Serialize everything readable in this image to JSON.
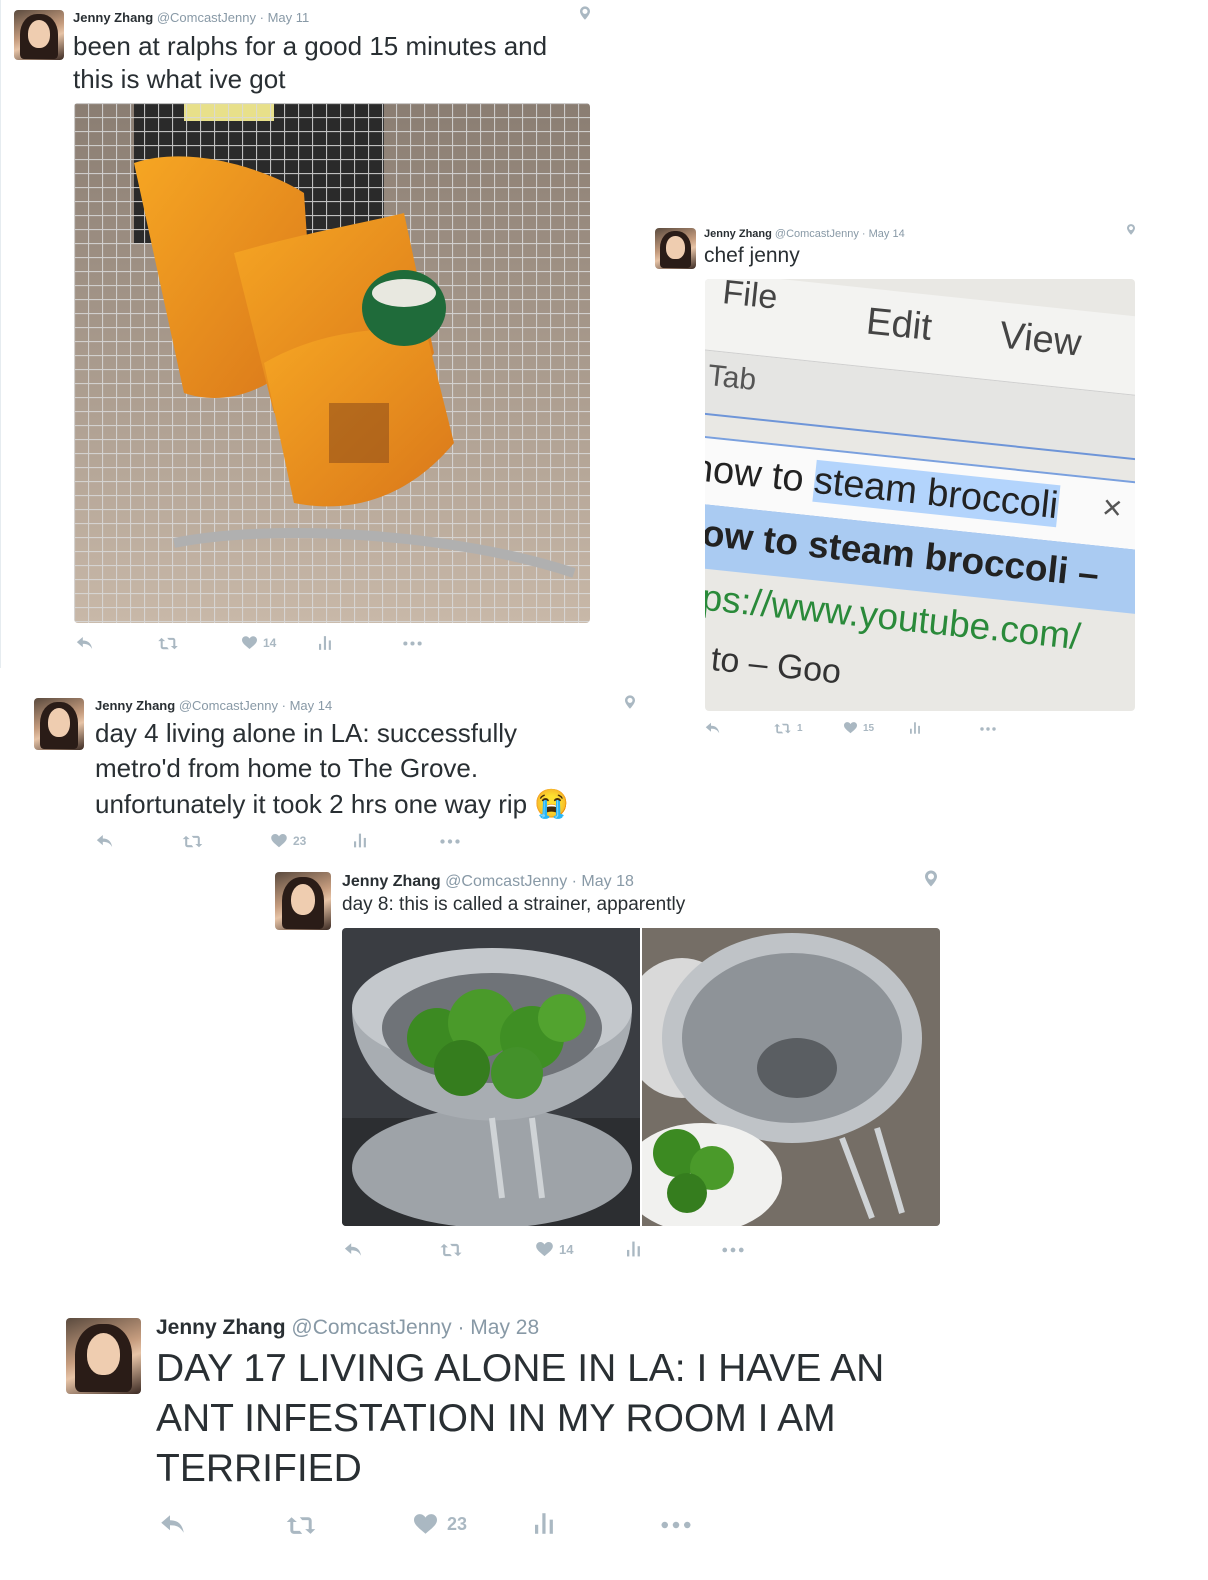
{
  "tweets": [
    {
      "name": "Jenny Zhang",
      "handle": "@ComcastJenny",
      "date": "· May 11",
      "text_line1": "been at ralphs for a good 15 minutes and",
      "text_line2": "this is what ive got",
      "likes": "14"
    },
    {
      "name": "Jenny Zhang",
      "handle": "@ComcastJenny",
      "date": "· May 14",
      "text": "chef jenny",
      "retweets": "1",
      "likes": "15",
      "screenshot": {
        "menu_file": "File",
        "menu_edit": "Edit",
        "menu_view": "View",
        "tab": "Tab",
        "search_prefix": "how to ",
        "search_highlight": "steam broccoli",
        "close": "×",
        "suggest_1": "how to steam broccoli –",
        "suggest_2": "https://www.youtube.com/",
        "suggest_3": "ow to – Goo"
      }
    },
    {
      "name": "Jenny Zhang",
      "handle": "@ComcastJenny",
      "date": "· May 14",
      "text_line1": "day 4 living alone in LA: successfully",
      "text_line2": "metro'd from home to The Grove.",
      "text_line3": "unfortunately it took 2 hrs one way rip",
      "emoji": "😭",
      "likes": "23"
    },
    {
      "name": "Jenny Zhang",
      "handle": "@ComcastJenny",
      "date": "· May 18",
      "text": "day 8: this is called a strainer, apparently",
      "likes": "14"
    },
    {
      "name": "Jenny Zhang",
      "handle": "@ComcastJenny",
      "date": "· May 28",
      "text_line1": "DAY 17 LIVING ALONE IN LA: I HAVE AN",
      "text_line2": "ANT INFESTATION IN MY ROOM I AM",
      "text_line3": "TERRIFIED",
      "likes": "23"
    }
  ],
  "icons": {
    "reply": "reply-icon",
    "retweet": "retweet-icon",
    "like": "heart-icon",
    "analytics": "analytics-icon",
    "more": "more-icon",
    "location": "location-pin-icon"
  },
  "colors": {
    "text": "#292f33",
    "meta": "#8899a6",
    "action": "#aab8c2",
    "highlight": "#b3d4fc"
  }
}
